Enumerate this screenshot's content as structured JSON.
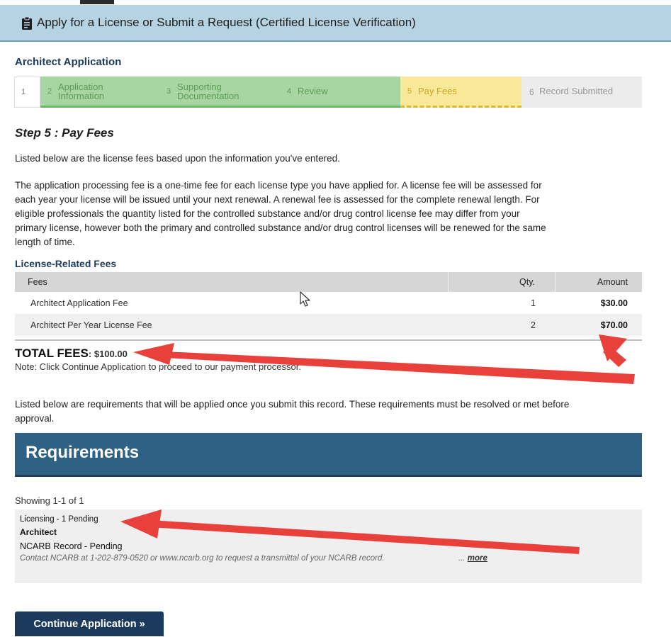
{
  "header": {
    "title": "Apply for a License or Submit a Request (Certified License Verification)"
  },
  "section_title": "Architect Application",
  "steps": [
    {
      "num": "1",
      "label": ""
    },
    {
      "num": "2",
      "label1": "Application",
      "label2": "Information"
    },
    {
      "num": "3",
      "label1": "Supporting",
      "label2": "Documentation"
    },
    {
      "num": "4",
      "label": "Review"
    },
    {
      "num": "5",
      "label": "Pay Fees"
    },
    {
      "num": "6",
      "label": "Record Submitted"
    }
  ],
  "step_heading": "Step 5 : Pay Fees",
  "intro_text": "Listed below are the license fees based upon the information you've entered.",
  "fee_explanation": [
    "The application processing fee is a one-time fee for each license type you have applied for.  A license fee will be assessed for",
    "each year your license will be issued until your next renewal.  A renewal fee is assessed for the complete renewal length.  For",
    "eligible professionals the quantity listed for the controlled substance and/or drug control license fee may differ from your",
    "primary license, however both the primary and controlled substance and/or drug control licenses will be renewed for the same",
    "length of time."
  ],
  "fees_section": {
    "title": "License-Related Fees",
    "headers": {
      "fees": "Fees",
      "qty": "Qty.",
      "amount": "Amount"
    },
    "rows": [
      {
        "fee": "Architect Application Fee",
        "qty": "1",
        "amount": "$30.00"
      },
      {
        "fee": "Architect Per Year License Fee",
        "qty": "2",
        "amount": "$70.00"
      }
    ],
    "total_label": "TOTAL FEES",
    "total_amount": ": $100.00",
    "note": "Note: Click Continue Application to proceed to our payment processor."
  },
  "requirements_intro": [
    "Listed below are requirements that will be applied once you submit this record. These requirements must be resolved or met before",
    "approval."
  ],
  "requirements": {
    "banner": "Requirements",
    "showing": "Showing 1-1 of 1",
    "group": "Licensing - 1 Pending",
    "license": "Architect",
    "item": "NCARB Record - Pending",
    "description": "Contact NCARB at 1-202-879-0520 or www.ncarb.org to request a transmittal of your NCARB record.",
    "ellipsis": "...",
    "more_link": "more"
  },
  "continue_button": "Continue Application »",
  "colors": {
    "header_bg": "#b5d3e3",
    "step_done": "#a8d6a3",
    "step_current": "#f9e897",
    "banner": "#2f6184",
    "button": "#1c3a5b",
    "annotation_arrow": "#e8413c"
  },
  "icons": {
    "header": "clipboard-icon",
    "cursor": "mouse-pointer-icon"
  }
}
